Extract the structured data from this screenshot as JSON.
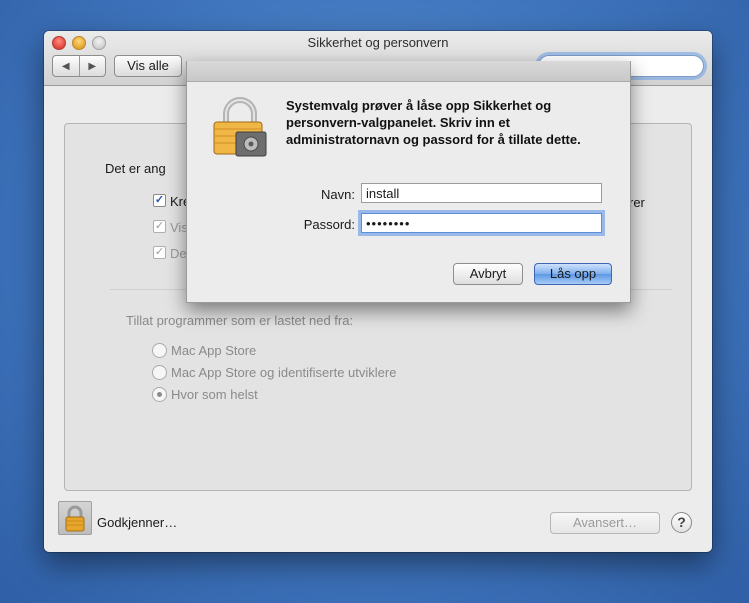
{
  "window": {
    "title": "Sikkerhet og personvern",
    "show_all_label": "Vis alle",
    "back_icon": "◀",
    "forward_icon": "▶"
  },
  "panel": {
    "partial_label": "Det er ang",
    "checkboxes": [
      {
        "label": "Kre",
        "checked": true,
        "enabled": true
      },
      {
        "label": "Vis",
        "checked": true,
        "enabled": false
      },
      {
        "label": "De",
        "checked": true,
        "enabled": false
      }
    ],
    "right_partial_text": "rer",
    "allow_label": "Tillat programmer som er lastet ned fra:",
    "radios": [
      {
        "label": "Mac App Store",
        "selected": false
      },
      {
        "label": "Mac App Store og identifiserte utviklere",
        "selected": false
      },
      {
        "label": "Hvor som helst",
        "selected": true
      }
    ]
  },
  "footer": {
    "lock_text": "Godkjenner…",
    "advanced_label": "Avansert…",
    "help_label": "?"
  },
  "dialog": {
    "message": "Systemvalg prøver å låse opp Sikkerhet og personvern-valgpanelet. Skriv inn et administratornavn og passord for å tillate dette.",
    "name_label": "Navn:",
    "name_value": "install",
    "password_label": "Passord:",
    "password_value": "••••••••",
    "cancel_label": "Avbryt",
    "unlock_label": "Lås opp"
  },
  "colors": {
    "accent": "#5d97e6",
    "desktop": "#3f75bd"
  }
}
